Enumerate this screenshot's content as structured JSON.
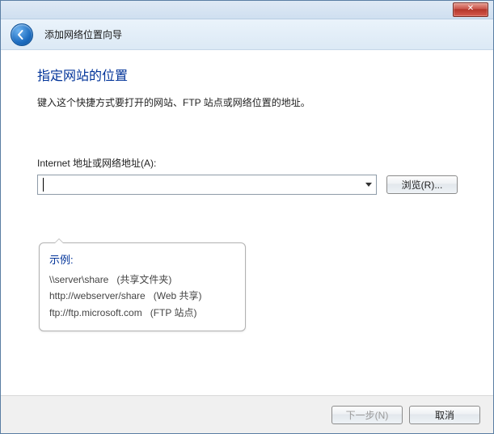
{
  "window": {
    "title": "添加网络位置向导"
  },
  "page": {
    "heading": "指定网站的位置",
    "instruction": "键入这个快捷方式要打开的网站、FTP 站点或网络位置的地址。",
    "address_label": "Internet 地址或网络地址(A):",
    "address_value": "",
    "browse_label": "浏览(R)..."
  },
  "examples": {
    "title": "示例:",
    "items": [
      {
        "path": "\\\\server\\share",
        "note": "(共享文件夹)"
      },
      {
        "path": "http://webserver/share",
        "note": "(Web 共享)"
      },
      {
        "path": "ftp://ftp.microsoft.com",
        "note": "(FTP 站点)"
      }
    ]
  },
  "footer": {
    "next_label": "下一步(N)",
    "cancel_label": "取消"
  }
}
